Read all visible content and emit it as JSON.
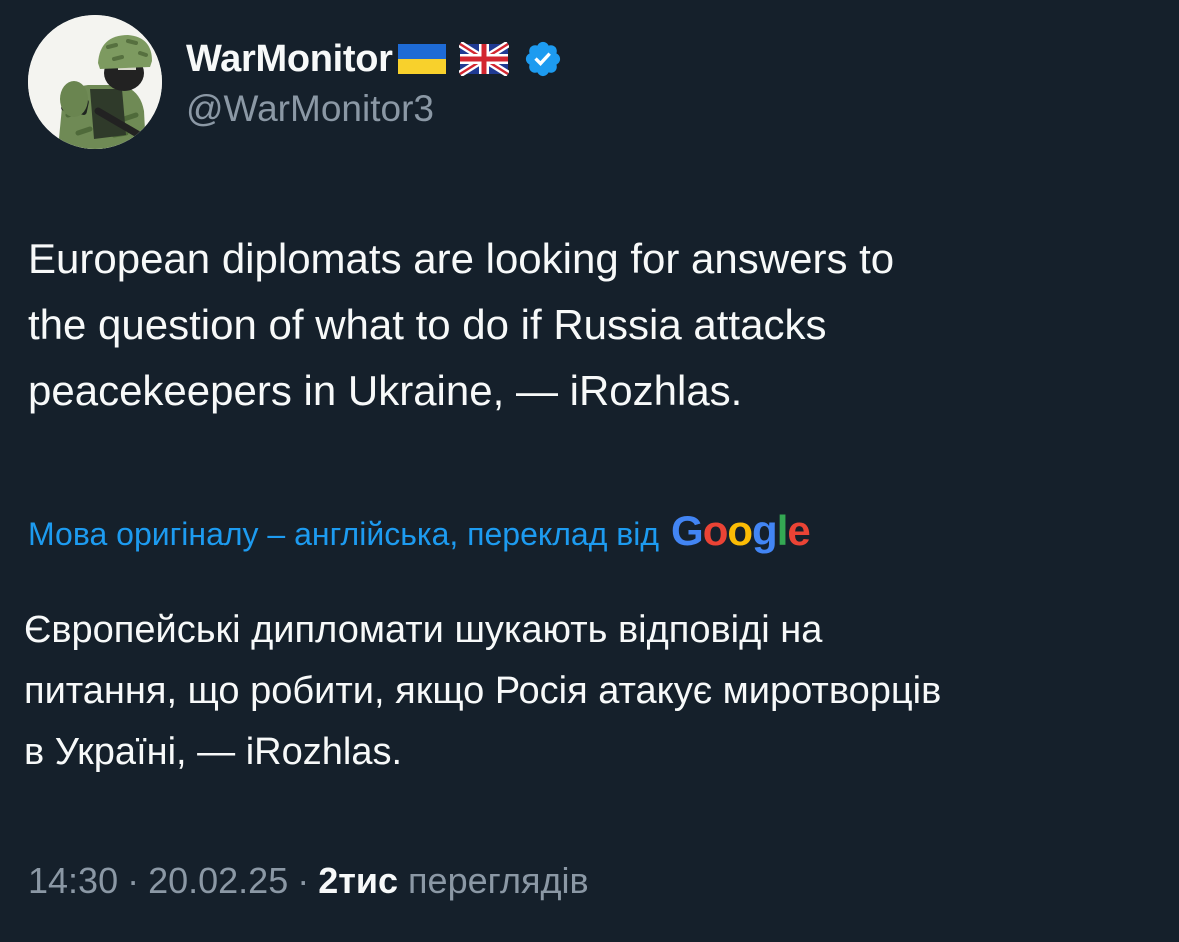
{
  "author": {
    "display_name": "WarMonitor",
    "handle": "@WarMonitor3",
    "flag_icons": [
      "ukraine-flag-icon",
      "uk-flag-icon"
    ],
    "verified_icon": "verified-badge-icon",
    "verified_color": "#1d9bf0"
  },
  "tweet": {
    "text": "European diplomats are looking for answers to\nthe question of what to do if Russia attacks\npeacekeepers in Ukraine, — iRozhlas.",
    "translation_label": "Мова оригіналу – англійська, переклад від",
    "translation_provider": "Google",
    "translated_text": "Європейські дипломати шукають відповіді на\nпитання, що робити, якщо Росія атакує миротворців\nв Україні, — iRozhlas."
  },
  "meta": {
    "time": "14:30",
    "separator": "·",
    "date": "20.02.25",
    "views_count": "2тис",
    "views_label": "переглядів"
  },
  "theme": {
    "background": "#15202b",
    "text_primary": "#f7f9f9",
    "text_secondary": "#8b98a5",
    "link": "#1d9bf0"
  }
}
